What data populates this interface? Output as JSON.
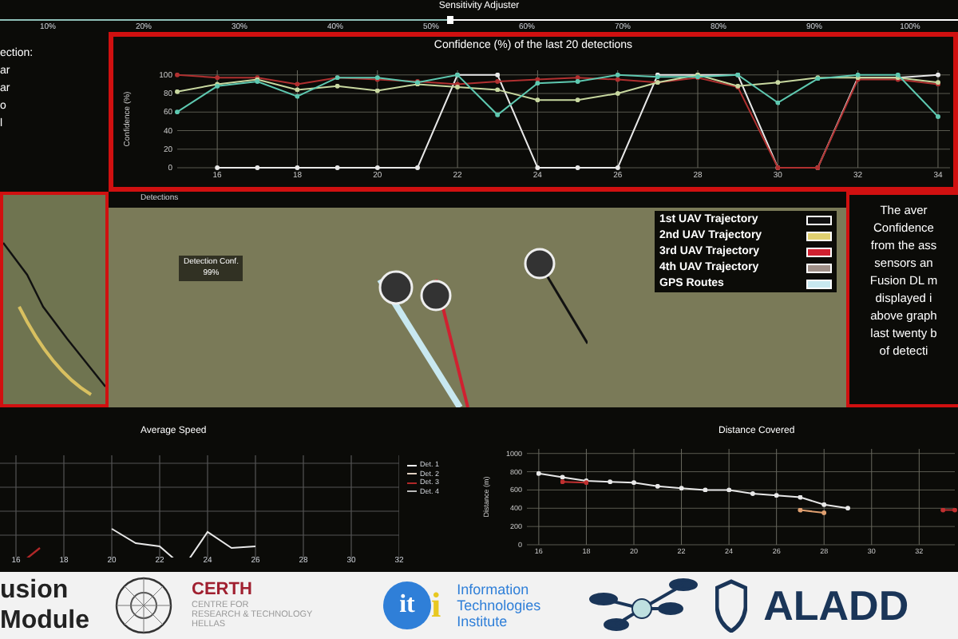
{
  "slider": {
    "title": "Sensitivity Adjuster",
    "level": 0.47,
    "ticks": [
      "10%",
      "20%",
      "30%",
      "40%",
      "50%",
      "60%",
      "70%",
      "80%",
      "90%",
      "100%"
    ]
  },
  "left_panel": {
    "lines": [
      "ection:",
      "ar",
      "ar",
      "o",
      "l"
    ]
  },
  "confidence_panel": {
    "chart_data": {
      "type": "line",
      "title": "Confidence (%) of the last 20 detections",
      "ylabel": "Confidence (%)",
      "x": [
        15,
        16,
        17,
        18,
        19,
        20,
        21,
        22,
        23,
        24,
        25,
        26,
        27,
        28,
        29,
        30,
        31,
        32,
        33,
        34
      ],
      "xlim": [
        15,
        34.3
      ],
      "ylim": [
        0,
        105
      ],
      "xticks": [
        16,
        18,
        20,
        22,
        24,
        26,
        28,
        30,
        32,
        34
      ],
      "yticks": [
        0,
        20,
        40,
        60,
        80,
        100
      ],
      "grid": true,
      "series": [
        {
          "color": "#e8e8e8",
          "values": [
            null,
            0,
            0,
            0,
            0,
            0,
            0,
            100,
            100,
            0,
            0,
            0,
            100,
            100,
            100,
            0,
            0,
            97,
            97,
            100
          ]
        },
        {
          "color": "#b03030",
          "values": [
            100,
            97,
            97,
            90,
            97,
            95,
            93,
            90,
            93,
            95,
            97,
            95,
            92,
            97,
            87,
            0,
            0,
            95,
            95,
            90
          ]
        },
        {
          "color": "#c8d8a0",
          "values": [
            82,
            90,
            95,
            84,
            88,
            83,
            90,
            87,
            84,
            73,
            73,
            80,
            92,
            100,
            88,
            92,
            97,
            97,
            97,
            92
          ]
        },
        {
          "color": "#5ec8b0",
          "values": [
            60,
            88,
            93,
            77,
            97,
            97,
            92,
            100,
            57,
            91,
            93,
            100,
            98,
            98,
            100,
            70,
            96,
            100,
            100,
            55
          ]
        }
      ]
    }
  },
  "detections": {
    "title": "Detections",
    "detection_box": {
      "label": "Detection Conf.",
      "value": "99%"
    },
    "legend": [
      {
        "label": "1st UAV Trajectory",
        "color": "#111111"
      },
      {
        "label": "2nd UAV Trajectory",
        "color": "#e0d070"
      },
      {
        "label": "3rd UAV Trajectory",
        "color": "#d02030"
      },
      {
        "label": "4th UAV Trajectory",
        "color": "#a09088"
      },
      {
        "label": "GPS Routes",
        "color": "#c8e8f0"
      }
    ]
  },
  "info_box": {
    "lines": [
      "The aver",
      "Confidence",
      "from the ass",
      "sensors an",
      "Fusion DL m",
      "displayed i",
      "above graph",
      "last twenty b",
      "of detecti"
    ]
  },
  "average_speed": {
    "title": "Average Speed",
    "xtick_labels": [
      "16",
      "18",
      "20",
      "22",
      "24",
      "26",
      "28",
      "30",
      "32"
    ],
    "legend": [
      "Det. 1",
      "Det. 2",
      "Det. 3",
      "Det. 4"
    ]
  },
  "distance_panel": {
    "chart_data": {
      "type": "line",
      "title": "Distance Covered",
      "ylabel": "Distance (m)",
      "x": [
        16,
        17,
        18,
        19,
        20,
        21,
        22,
        23,
        24,
        25,
        26,
        27,
        28,
        29,
        33,
        33.5
      ],
      "xlim": [
        15.5,
        33.5
      ],
      "ylim": [
        0,
        1050
      ],
      "xticks": [
        16,
        18,
        20,
        22,
        24,
        26,
        28,
        30,
        32
      ],
      "yticks": [
        0,
        200,
        400,
        600,
        800,
        1000
      ],
      "grid": true,
      "series": [
        {
          "color": "#e8e8e8",
          "values": [
            780,
            740,
            700,
            690,
            680,
            640,
            620,
            600,
            600,
            560,
            540,
            520,
            440,
            400,
            null,
            null
          ]
        },
        {
          "color": "#c03030",
          "values": [
            null,
            690,
            680,
            null,
            null,
            null,
            null,
            null,
            null,
            null,
            null,
            null,
            null,
            null,
            380,
            380
          ]
        },
        {
          "color": "#e0a070",
          "values": [
            null,
            null,
            null,
            null,
            null,
            null,
            null,
            null,
            null,
            null,
            null,
            380,
            350,
            null,
            null,
            null
          ]
        }
      ]
    }
  },
  "logos": {
    "module_lines": [
      "usion",
      "Module"
    ],
    "certh": {
      "name": "CERTH",
      "lines": [
        "CENTRE FOR",
        "RESEARCH & TECHNOLOGY",
        "HELLAS"
      ]
    },
    "iti": {
      "mark": "it",
      "mark_i": "i",
      "lines": [
        "Information",
        "Technologies",
        "Institute"
      ]
    },
    "aladd": "ALADD"
  }
}
